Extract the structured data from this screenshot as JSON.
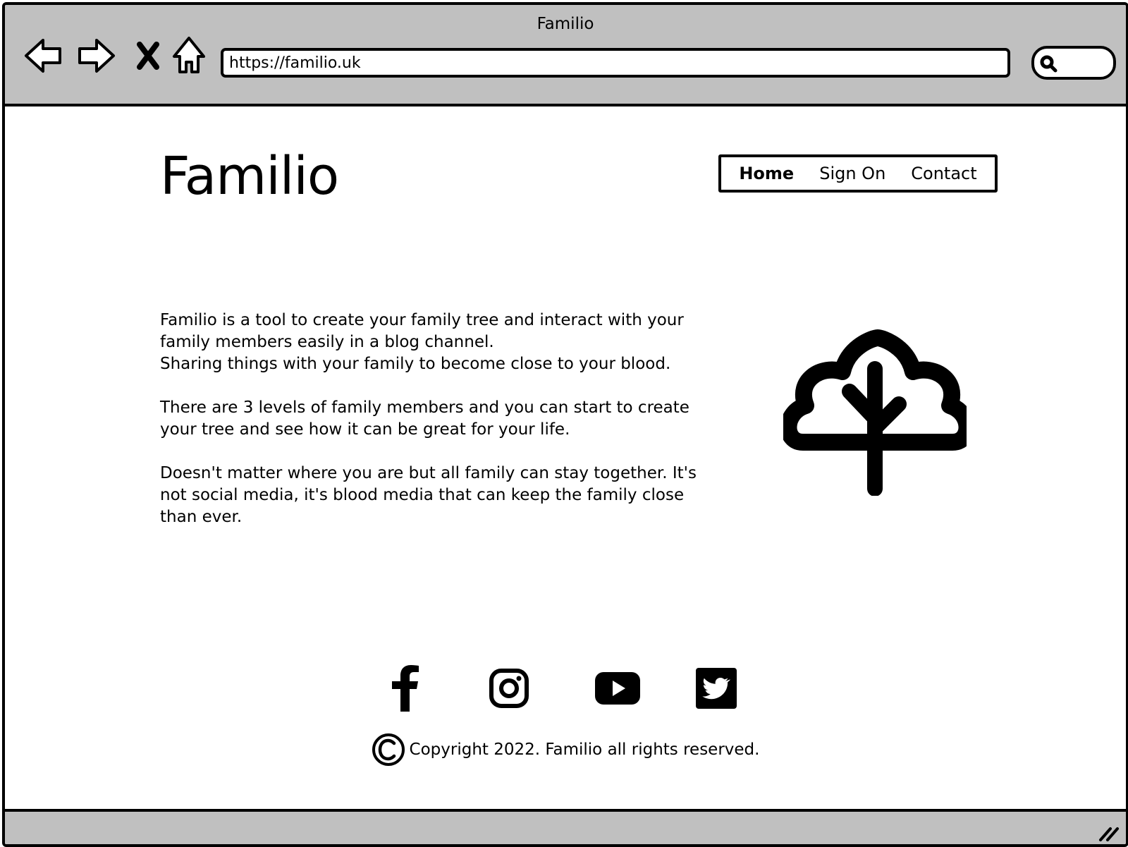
{
  "browser": {
    "window_title": "Familio",
    "url": "https://familio.uk",
    "nav": {
      "back_icon": "arrow-left-icon",
      "forward_icon": "arrow-right-icon",
      "stop_icon": "close-icon",
      "home_icon": "home-icon",
      "search_icon": "search-icon"
    }
  },
  "site": {
    "logo": "Familio",
    "menu": [
      {
        "label": "Home",
        "active": true
      },
      {
        "label": "Sign On",
        "active": false
      },
      {
        "label": "Contact",
        "active": false
      }
    ]
  },
  "about": {
    "paragraphs": [
      [
        "Familio is a tool to create your family tree and interact with your family members easily in a blog channel.",
        "Sharing things with your family to become close to your blood."
      ],
      [
        "There are 3 levels of family members and you can start to create your tree and see how it can be great for your life."
      ],
      [
        "Doesn't matter where you are but all family can stay together. It's not social media, it's blood media that can keep the family close than ever."
      ]
    ],
    "illustration_icon": "tree-icon"
  },
  "footer": {
    "social": [
      {
        "icon": "facebook-icon"
      },
      {
        "icon": "instagram-icon"
      },
      {
        "icon": "youtube-icon"
      },
      {
        "icon": "twitter-icon"
      }
    ],
    "copyright_icon": "copyright-icon",
    "copyright_text": "Copyright 2022. Familio all rights reserved."
  }
}
